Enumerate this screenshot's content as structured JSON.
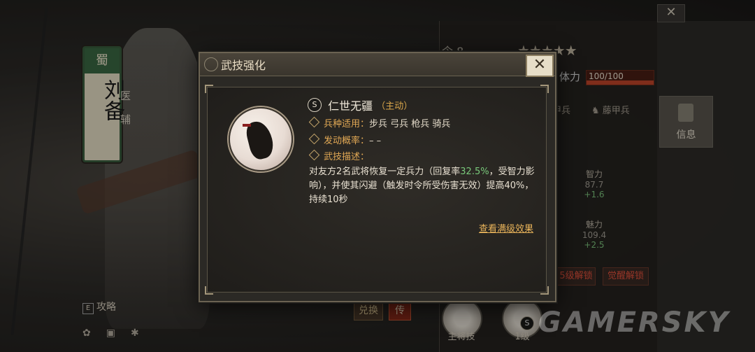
{
  "background": {
    "banner": {
      "faction": "蜀",
      "name": "刘备"
    },
    "roles": [
      "医",
      "辅"
    ],
    "strategy_label": "攻略",
    "swap_label": "兑换",
    "legend_label": "传",
    "watermark": "GAMERSKY"
  },
  "right_panel": {
    "level_prefix": "令",
    "level": "8",
    "stars": "★★★★★",
    "stamina_label": "体力",
    "stamina_value": "100/100",
    "stamina_fraction": 1.0,
    "armor_tags": [
      "甲兵",
      "藤甲兵"
    ],
    "info_tab_label": "信息",
    "stats": [
      {
        "label": "智力",
        "value": "87.7",
        "bonus": "+1.6"
      },
      {
        "label": "魅力",
        "value": "109.4",
        "bonus": "+2.5"
      }
    ],
    "unlock_buttons": [
      "5级解锁",
      "觉醒解锁"
    ],
    "slots": [
      {
        "label": "主将技"
      },
      {
        "label": "1级",
        "badge": "S"
      }
    ]
  },
  "modal": {
    "title": "武技强化",
    "close_label": "✕",
    "skill": {
      "badge": "S",
      "name": "仁世无疆",
      "type": "（主动）",
      "troop_label": "兵种适用：",
      "troop_value": "步兵 弓兵 枪兵 骑兵",
      "chance_label": "发动概率：",
      "chance_value": "– –",
      "desc_label": "武技描述：",
      "desc_before": "对友方2名武将恢复一定兵力（回复率",
      "desc_highlight": "32.5%",
      "desc_after": "，受智力影响），并使其闪避（触发时令所受伤害无效）提高40%，持续10秒"
    },
    "full_level_link": "查看满级效果"
  },
  "colors": {
    "accent_gold": "#e2a955",
    "highlight_green": "#79c97b",
    "danger_red": "#e9533e"
  }
}
